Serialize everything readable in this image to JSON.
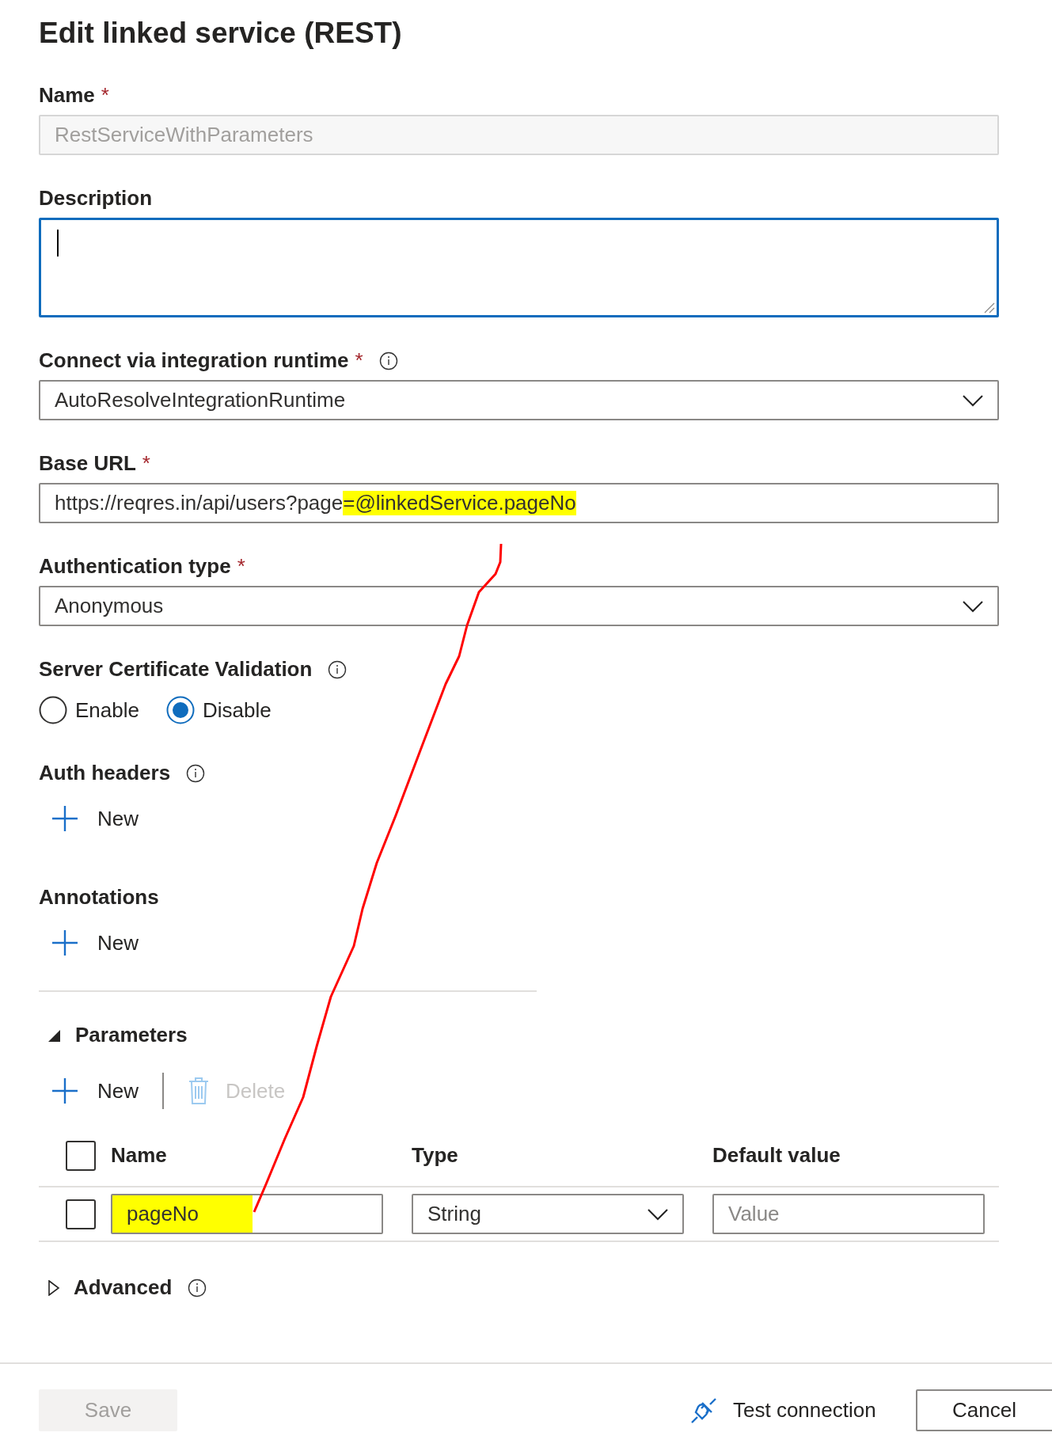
{
  "title": "Edit linked service (REST)",
  "fields": [
    {
      "kind": "text",
      "label": "Name",
      "required_mark": "*",
      "disabled": true,
      "value_parts": [
        {
          "text": "RestServiceWithParameters",
          "highlighted": false
        }
      ]
    },
    {
      "kind": "textarea",
      "label": "Description",
      "focused": true
    },
    {
      "kind": "select",
      "label": "Connect via integration runtime",
      "required_mark": "*",
      "info": true,
      "value": "AutoResolveIntegrationRuntime"
    },
    {
      "kind": "text",
      "label": "Base URL",
      "required_mark": "*",
      "disabled": false,
      "value_parts": [
        {
          "text": "https://reqres.in/api/users?page",
          "highlighted": false
        },
        {
          "text": "=@linkedService.pageNo",
          "highlighted": true
        }
      ]
    },
    {
      "kind": "select",
      "label": "Authentication type",
      "required_mark": "*",
      "value": "Anonymous"
    },
    {
      "kind": "radio",
      "label": "Server Certificate Validation",
      "info": true,
      "options": [
        {
          "label": "Enable",
          "selected": false
        },
        {
          "label": "Disable",
          "selected": true
        }
      ]
    },
    {
      "kind": "list",
      "label": "Auth headers",
      "info": true,
      "new_label": "New"
    },
    {
      "kind": "list",
      "label": "Annotations",
      "new_label": "New"
    }
  ],
  "parameters": {
    "label": "Parameters",
    "expanded": true,
    "new_label": "New",
    "delete_label": "Delete",
    "delete_disabled": true,
    "columns": [
      "Name",
      "Type",
      "Default value"
    ],
    "all_checked": false,
    "rows": [
      {
        "checked": false,
        "name": "pageNo",
        "name_highlighted": true,
        "type": "String",
        "placeholder": "Value"
      }
    ]
  },
  "advanced": {
    "label": "Advanced",
    "expanded": false,
    "info": true
  },
  "footer": {
    "save": "Save",
    "save_disabled": true,
    "test": "Test connection",
    "cancel": "Cancel"
  }
}
